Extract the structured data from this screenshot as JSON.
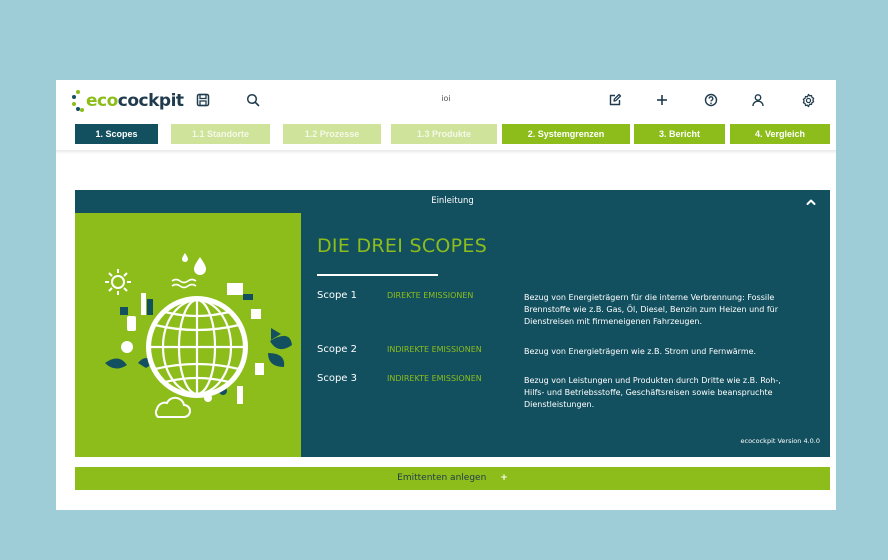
{
  "brand": {
    "logo_prefix": "eco",
    "logo_suffix": "cockpit"
  },
  "topbar": {
    "center_title": "ioi",
    "icons_left": [
      "save-icon",
      "search-icon"
    ],
    "icons_right": [
      "edit-icon",
      "plus-icon",
      "help-icon",
      "user-icon",
      "settings-icon"
    ]
  },
  "tabs": [
    {
      "label": "1. Scopes",
      "state": "active"
    },
    {
      "label": "1.1 Standorte",
      "state": "disabled"
    },
    {
      "label": "1.2 Prozesse",
      "state": "disabled"
    },
    {
      "label": "1.3 Produkte",
      "state": "disabled"
    },
    {
      "label": "2. Systemgrenzen",
      "state": "enabled"
    },
    {
      "label": "3. Bericht",
      "state": "enabled"
    },
    {
      "label": "4. Vergleich",
      "state": "enabled"
    }
  ],
  "panel": {
    "title": "Einleitung",
    "heading": "DIE DREI SCOPES",
    "scopes": [
      {
        "name": "Scope 1",
        "type": "DIREKTE EMISSIONEN",
        "lines": [
          "Bezug von Energieträgern für die interne Verbrennung: Fossile",
          "Brennstoffe wie z.B. Gas, Öl, Diesel, Benzin zum Heizen und für",
          "Dienstreisen mit firmeneigenen Fahrzeugen."
        ]
      },
      {
        "name": "Scope 2",
        "type": "INDIREKTE EMISSIONEN",
        "lines": [
          "Bezug von Energieträgern wie z.B. Strom und Fernwärme."
        ]
      },
      {
        "name": "Scope 3",
        "type": "INDIREKTE EMISSIONEN",
        "lines": [
          "Bezug von Leistungen und Produkten durch Dritte wie z.B. Roh-,",
          "Hilfs- und Betriebsstoffe, Geschäftsreisen sowie beanspruchte",
          "Dienstleistungen."
        ]
      }
    ],
    "version": "ecocockpit Version 4.0.0"
  },
  "add_bar": {
    "label": "Emittenten anlegen",
    "plus": "+"
  },
  "colors": {
    "background": "#9ecdd8",
    "dark_teal": "#13505f",
    "green": "#8cbd1b",
    "light_green": "#cfe39a"
  }
}
